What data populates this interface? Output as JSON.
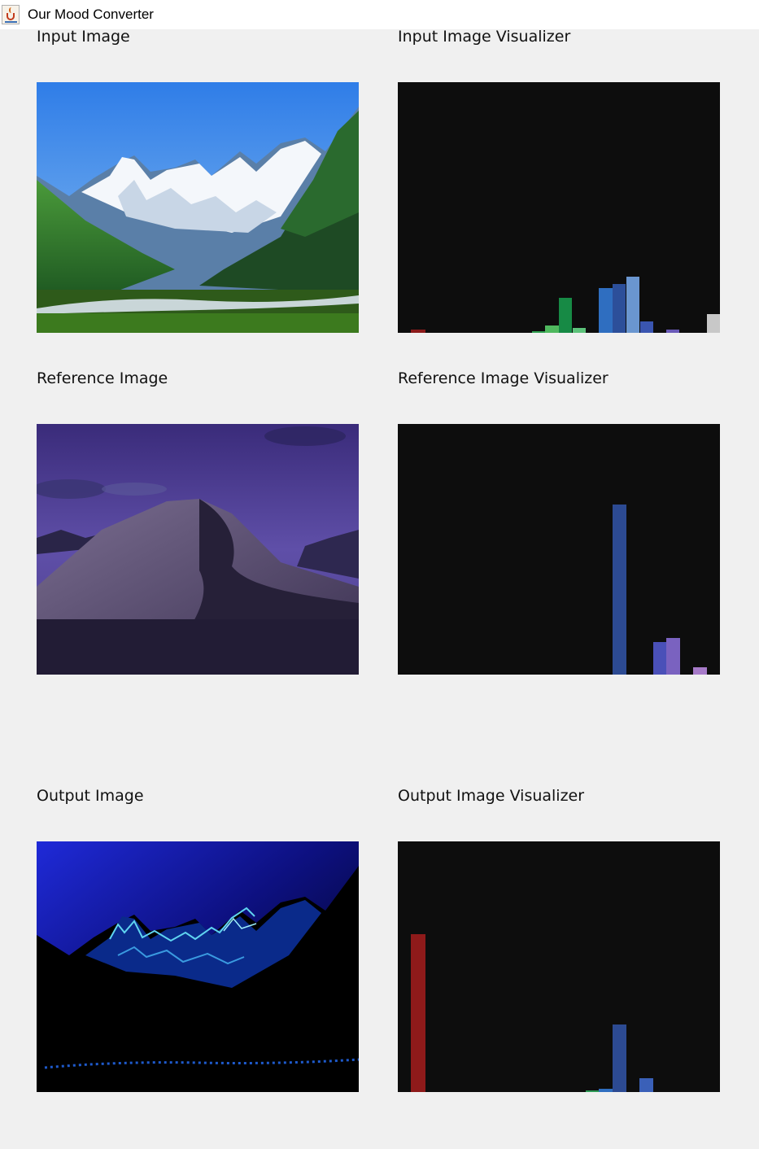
{
  "window": {
    "title": "Our Mood Converter",
    "icon": "java-cup-icon"
  },
  "rows": [
    {
      "image_label": "Input Image",
      "visualizer_label": "Input Image Visualizer",
      "image_description_key": "input",
      "histogram": [
        {
          "color": "#8b1a1a",
          "value": 0.013
        },
        {
          "color": "#2f9e4f",
          "value": 0.006
        },
        {
          "color": "#4fb85e",
          "value": 0.03
        },
        {
          "color": "#178a45",
          "value": 0.14
        },
        {
          "color": "#5cc27a",
          "value": 0.018
        },
        {
          "color": "#2f6ec0",
          "value": 0.18
        },
        {
          "color": "#2c4f9a",
          "value": 0.195
        },
        {
          "color": "#6a96d0",
          "value": 0.225
        },
        {
          "color": "#3a55b0",
          "value": 0.045
        },
        {
          "color": "#6a5ab8",
          "value": 0.013
        },
        {
          "color": "#c8c8c8",
          "value": 0.075
        }
      ]
    },
    {
      "image_label": "Reference Image",
      "visualizer_label": "Reference Image Visualizer",
      "image_description_key": "reference",
      "histogram": [
        {
          "color": "#2c4a92",
          "value": 0.68
        },
        {
          "color": "#4a50b8",
          "value": 0.13
        },
        {
          "color": "#7a62c0",
          "value": 0.145
        },
        {
          "color": "#a67ac8",
          "value": 0.03
        }
      ]
    },
    {
      "image_label": "Output Image",
      "visualizer_label": "Output Image Visualizer",
      "image_description_key": "output",
      "histogram": [
        {
          "color": "#8e1a1a",
          "value": 0.63
        },
        {
          "color": "#2e9a56",
          "value": 0.005
        },
        {
          "color": "#2f6ec0",
          "value": 0.012
        },
        {
          "color": "#2c4a92",
          "value": 0.27
        },
        {
          "color": "#3a60b8",
          "value": 0.055
        }
      ]
    }
  ]
}
